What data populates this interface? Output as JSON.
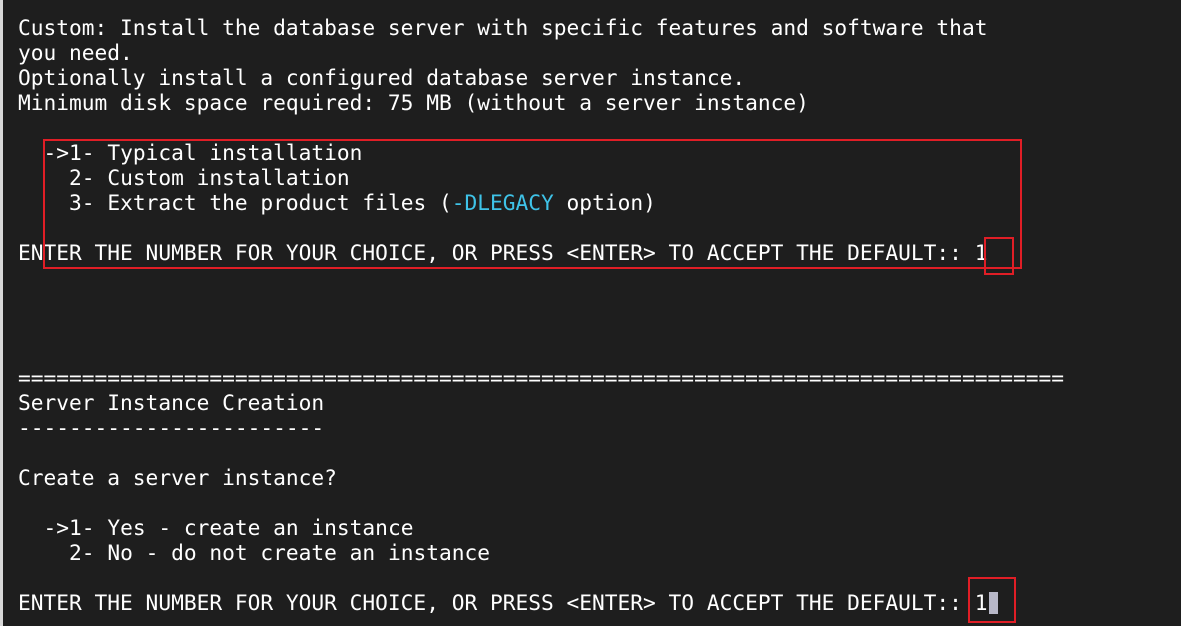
{
  "install": {
    "description": [
      "Custom: Install the database server with specific features and software that",
      "you need.",
      "Optionally install a configured database server instance.",
      "Minimum disk space required: 75 MB (without a server instance)"
    ],
    "options": [
      {
        "marker": "->",
        "number": "1-",
        "label": "Typical installation"
      },
      {
        "marker": "  ",
        "number": "2-",
        "label": "Custom installation"
      },
      {
        "marker": "  ",
        "number": "3-",
        "label_before": "Extract the product files (",
        "highlight": "-DLEGACY",
        "label_after": " option)"
      }
    ],
    "prompt": "ENTER THE NUMBER FOR YOUR CHOICE, OR PRESS <ENTER> TO ACCEPT THE DEFAULT:: ",
    "answer": "1"
  },
  "server_instance": {
    "separator": "==================================================================================",
    "title": "Server Instance Creation",
    "underline": "------------------------",
    "question": "Create a server instance?",
    "options": [
      {
        "marker": "->",
        "number": "1-",
        "label": "Yes - create an instance"
      },
      {
        "marker": "  ",
        "number": "2-",
        "label": "No - do not create an instance"
      }
    ],
    "prompt": "ENTER THE NUMBER FOR YOUR CHOICE, OR PRESS <ENTER> TO ACCEPT THE DEFAULT:: ",
    "answer": "1"
  },
  "colors": {
    "background": "#1e1e1e",
    "text": "#ffffff",
    "option_highlight": "#3fc3e8",
    "annotation_box": "#e01e26"
  }
}
